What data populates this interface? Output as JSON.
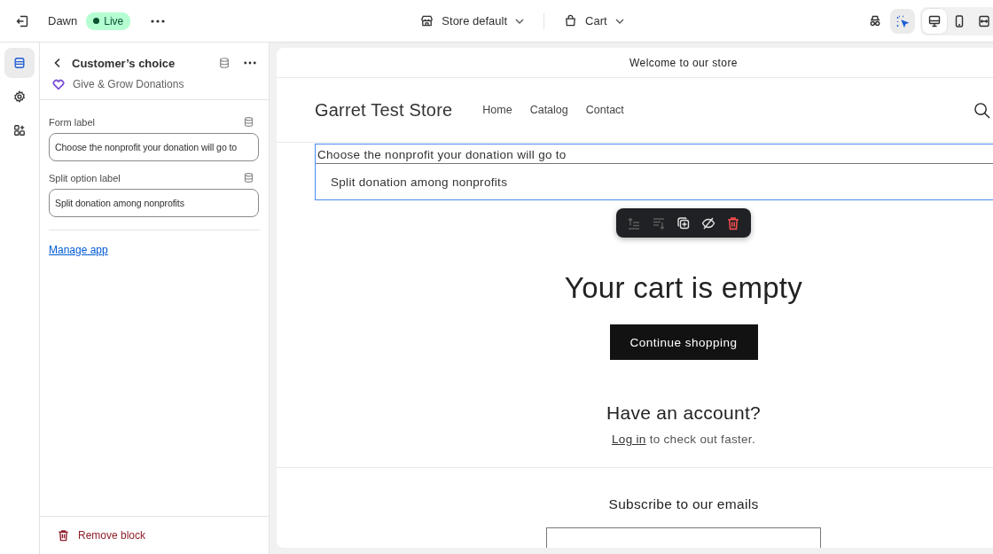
{
  "topbar": {
    "theme": "Dawn",
    "status": {
      "label": "Live",
      "kind": "live"
    },
    "store_selector": "Store default",
    "template_selector": "Cart",
    "inspector": {
      "on": true
    },
    "views": [
      {
        "kind": "desktop",
        "selected": true
      },
      {
        "kind": "mobile",
        "selected": false
      },
      {
        "kind": "fullwidth",
        "selected": false
      }
    ]
  },
  "rail": [
    {
      "kind": "sections",
      "selected": true
    },
    {
      "kind": "settings",
      "selected": false
    },
    {
      "kind": "apps",
      "selected": false
    }
  ],
  "panel": {
    "title": "Customer’s choice",
    "app_name": "Give & Grow Donations",
    "fields": [
      {
        "label": "Form label",
        "value": "Choose the nonprofit your donation will go to"
      },
      {
        "label": "Split option label",
        "value": "Split donation among nonprofits"
      }
    ],
    "link": "Manage app",
    "remove": "Remove block"
  },
  "preview": {
    "announcement": "Welcome to our store",
    "store_name": "Garret Test Store",
    "nav": [
      "Home",
      "Catalog",
      "Contact"
    ],
    "block": {
      "label": "Choose the nonprofit your donation will go to",
      "option": "Split donation among nonprofits",
      "selected": true
    },
    "toolbar": [
      {
        "kind": "move-up",
        "disabled": true
      },
      {
        "kind": "move-down",
        "disabled": true
      },
      {
        "kind": "duplicate",
        "disabled": false
      },
      {
        "kind": "hide",
        "disabled": false
      },
      {
        "kind": "delete",
        "disabled": false
      }
    ],
    "heading": "Your cart is empty",
    "button": "Continue shopping",
    "account_heading": "Have an account?",
    "login_link": "Log in",
    "login_text": "to check out faster.",
    "subscribe": "Subscribe to our emails"
  }
}
